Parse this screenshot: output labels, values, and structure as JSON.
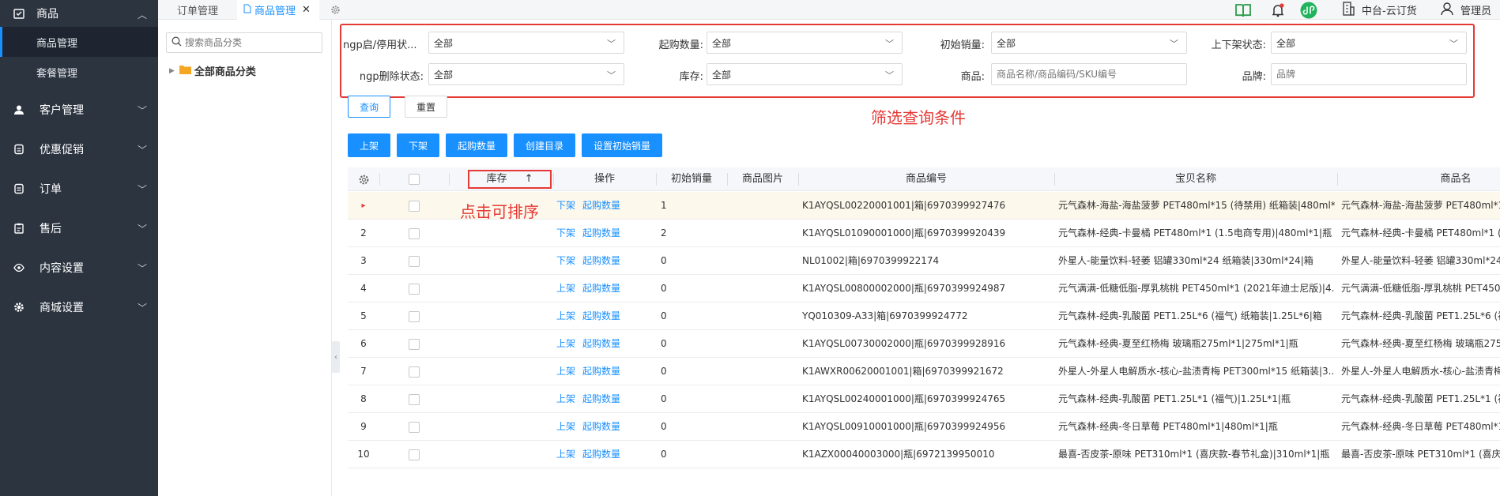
{
  "sidebar": {
    "group": {
      "label": "商品",
      "icon": "product-icon"
    },
    "sub_items": [
      {
        "label": "商品管理",
        "active": true
      },
      {
        "label": "套餐管理",
        "active": false
      }
    ],
    "items": [
      {
        "label": "客户管理",
        "icon": "user-icon"
      },
      {
        "label": "优惠促销",
        "icon": "promo-icon"
      },
      {
        "label": "订单",
        "icon": "order-icon"
      },
      {
        "label": "售后",
        "icon": "aftersale-icon"
      },
      {
        "label": "内容设置",
        "icon": "eye-icon"
      },
      {
        "label": "商城设置",
        "icon": "gear-icon"
      }
    ]
  },
  "tabs": [
    {
      "label": "订单管理",
      "active": false
    },
    {
      "label": "商品管理",
      "active": true
    }
  ],
  "header": {
    "store": "中台-云订货",
    "user": "管理员"
  },
  "tree": {
    "search_placeholder": "搜索商品分类",
    "root": "全部商品分类"
  },
  "filters": {
    "ngp_status": {
      "label": "ngp启/停用状...",
      "value": "全部"
    },
    "min_qty": {
      "label": "起购数量:",
      "value": "全部"
    },
    "init_sales": {
      "label": "初始销量:",
      "value": "全部"
    },
    "shelf_status": {
      "label": "上下架状态:",
      "value": "全部"
    },
    "ngp_deleted": {
      "label": "ngp删除状态:",
      "value": "全部"
    },
    "stock": {
      "label": "库存:",
      "value": "全部"
    },
    "product": {
      "label": "商品:",
      "placeholder": "商品名称/商品编码/SKU编号"
    },
    "brand": {
      "label": "品牌:",
      "placeholder": "品牌"
    }
  },
  "annotations": {
    "filter": "筛选查询条件",
    "sort": "点击可排序"
  },
  "buttons": {
    "query": "查询",
    "reset": "重置",
    "on_shelf": "上架",
    "off_shelf": "下架",
    "min_qty": "起购数量",
    "create_catalog": "创建目录",
    "set_init_sales": "设置初始销量"
  },
  "table": {
    "headers": {
      "stock": "库存",
      "action": "操作",
      "init_sales": "初始销量",
      "image": "商品图片",
      "code": "商品编号",
      "title": "宝贝名称",
      "name": "商品名"
    },
    "sort_icon": "↑",
    "action_min_qty": "起购数量",
    "rows": [
      {
        "idx": "▸",
        "shelf": "下架",
        "sales": "1",
        "code": "K1AYQSL00220001001|箱|6970399927476",
        "title": "元气森林-海盐-海盐菠萝 PET480ml*15 (待禁用) 纸箱装|480ml*...",
        "name": "元气森林-海盐-海盐菠萝 PET480ml*1"
      },
      {
        "idx": "2",
        "shelf": "下架",
        "sales": "2",
        "code": "K1AYQSL01090001000|瓶|6970399920439",
        "title": "元气森林-经典-卡曼橘 PET480ml*1 (1.5电商专用)|480ml*1|瓶",
        "name": "元气森林-经典-卡曼橘 PET480ml*1 (1"
      },
      {
        "idx": "3",
        "shelf": "下架",
        "sales": "0",
        "code": "NL01002|箱|6970399922174",
        "title": "外星人-能量饮料-轻萎 铝罐330ml*24 纸箱装|330ml*24|箱",
        "name": "外星人-能量饮料-轻萎 铝罐330ml*24"
      },
      {
        "idx": "4",
        "shelf": "上架",
        "sales": "0",
        "code": "K1AYQSL00800002000|瓶|6970399924987",
        "title": "元气满满-低糖低脂-厚乳桃桃 PET450ml*1 (2021年迪士尼版)|4...",
        "name": "元气满满-低糖低脂-厚乳桃桃 PET450"
      },
      {
        "idx": "5",
        "shelf": "上架",
        "sales": "0",
        "code": "YQ010309-A33|箱|6970399924772",
        "title": "元气森林-经典-乳酸菌 PET1.25L*6 (福气) 纸箱装|1.25L*6|箱",
        "name": "元气森林-经典-乳酸菌 PET1.25L*6 (福"
      },
      {
        "idx": "6",
        "shelf": "上架",
        "sales": "0",
        "code": "K1AYQSL00730002000|瓶|6970399928916",
        "title": "元气森林-经典-夏至红杨梅 玻璃瓶275ml*1|275ml*1|瓶",
        "name": "元气森林-经典-夏至红杨梅 玻璃瓶275"
      },
      {
        "idx": "7",
        "shelf": "上架",
        "sales": "0",
        "code": "K1AWXR00620001001|箱|6970399921672",
        "title": "外星人-外星人电解质水-核心-盐渍青梅 PET300ml*15 纸箱装|3...",
        "name": "外星人-外星人电解质水-核心-盐渍青梅"
      },
      {
        "idx": "8",
        "shelf": "上架",
        "sales": "0",
        "code": "K1AYQSL00240001000|瓶|6970399924765",
        "title": "元气森林-经典-乳酸菌 PET1.25L*1 (福气)|1.25L*1|瓶",
        "name": "元气森林-经典-乳酸菌 PET1.25L*1 (福"
      },
      {
        "idx": "9",
        "shelf": "上架",
        "sales": "0",
        "code": "K1AYQSL00910001000|瓶|6970399924956",
        "title": "元气森林-经典-冬日草莓 PET480ml*1|480ml*1|瓶",
        "name": "元气森林-经典-冬日草莓 PET480ml*1"
      },
      {
        "idx": "10",
        "shelf": "上架",
        "sales": "0",
        "code": "K1AZX00040003000|瓶|6972139950010",
        "title": "最喜-否皮茶-原味 PET310ml*1 (喜庆款-春节礼盒)|310ml*1|瓶",
        "name": "最喜-否皮茶-原味 PET310ml*1 (喜庆款"
      }
    ]
  },
  "colors": {
    "accent": "#1890ff",
    "annotation": "#e53935",
    "sidebar": "#2c3440",
    "selected_row": "#fdf8ec"
  }
}
